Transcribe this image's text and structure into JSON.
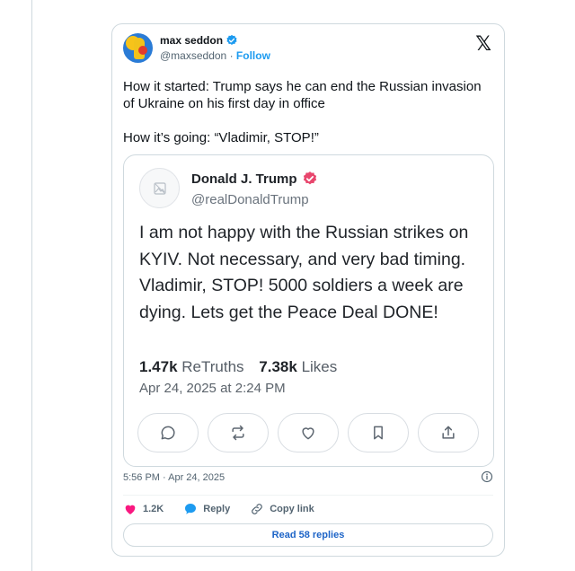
{
  "author": {
    "name": "max seddon",
    "handle": "@maxseddon",
    "separator": "·",
    "follow_label": "Follow"
  },
  "tweet": {
    "line1": "How it started: Trump says he can end the Russian invasion of Ukraine on his first day in office",
    "line2": "How it’s going: “Vladimir, STOP!”"
  },
  "quote": {
    "name": "Donald J. Trump",
    "handle": "@realDonaldTrump",
    "body": "I am not happy with the Russian strikes on KYIV. Not necessary, and very bad timing. Vladimir, STOP! 5000 soldiers a week are dying. Lets get the Peace Deal DONE!",
    "retruths_count": "1.47k",
    "retruths_label": "ReTruths",
    "likes_count": "7.38k",
    "likes_label": "Likes",
    "date": "Apr 24, 2025 at 2:24 PM",
    "actions": [
      "reply-icon",
      "retruth-icon",
      "like-icon",
      "bookmark-icon",
      "share-icon"
    ]
  },
  "meta": {
    "timestamp": "5:56 PM · Apr 24, 2025"
  },
  "actions": {
    "like_count": "1.2K",
    "reply_label": "Reply",
    "copy_label": "Copy link"
  },
  "replies": {
    "label": "Read 58 replies"
  },
  "colors": {
    "accent": "#1d9bf0",
    "like": "#f91880",
    "truth_badge": "#e8466d"
  }
}
